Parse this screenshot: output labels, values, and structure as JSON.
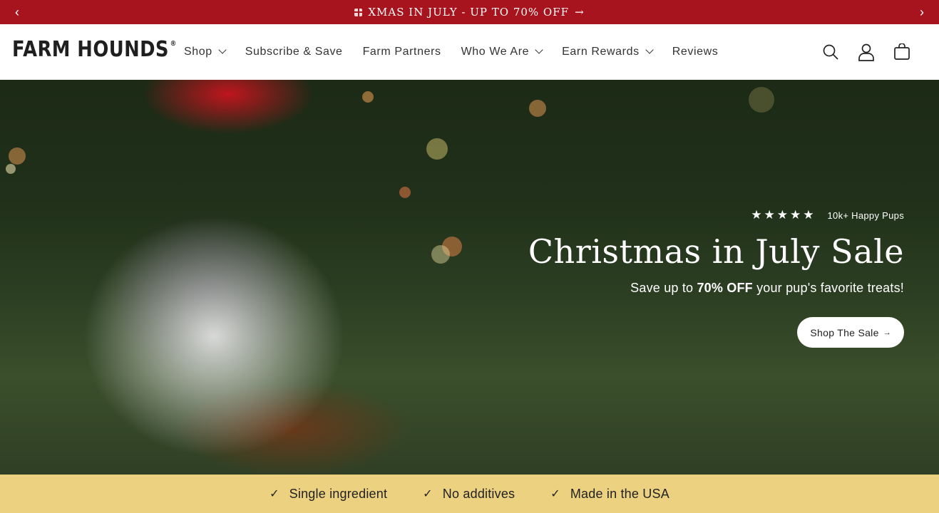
{
  "announcement": {
    "text": "XMAS IN JULY - UP TO 70% OFF",
    "arrow": "→",
    "prev": "‹",
    "next": "›"
  },
  "header": {
    "logo": "FARM HOUNDS",
    "logo_mark": "®",
    "nav": [
      {
        "label": "Shop",
        "dropdown": true
      },
      {
        "label": "Subscribe & Save",
        "dropdown": false
      },
      {
        "label": "Farm Partners",
        "dropdown": false
      },
      {
        "label": "Who We Are",
        "dropdown": true
      },
      {
        "label": "Earn Rewards",
        "dropdown": true
      },
      {
        "label": "Reviews",
        "dropdown": false
      }
    ],
    "icons": [
      "search-icon",
      "account-icon",
      "cart-icon"
    ]
  },
  "hero": {
    "stars": "★★★★★",
    "rating_text": "10k+ Happy Pups",
    "title": "Christmas in July Sale",
    "subtitle_pre": "Save up to",
    "subtitle_bold": "70% OFF",
    "subtitle_post": "your pup's favorite treats!",
    "cta_label": "Shop The Sale",
    "cta_arrow": "→"
  },
  "features": [
    {
      "check": "✓",
      "label": "Single ingredient"
    },
    {
      "check": "✓",
      "label": "No additives"
    },
    {
      "check": "✓",
      "label": "Made in the USA"
    }
  ],
  "colors": {
    "announcement_bg": "#a8141d",
    "features_bg": "#ecd280",
    "text_dark": "#1f1f1f"
  }
}
